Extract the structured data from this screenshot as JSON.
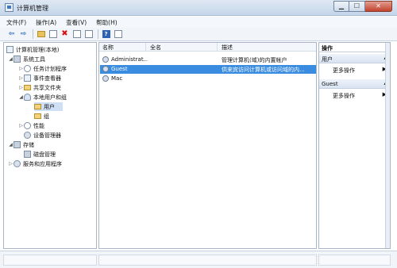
{
  "window": {
    "title": "计算机管理"
  },
  "menu": [
    "文件(F)",
    "操作(A)",
    "查看(V)",
    "帮助(H)"
  ],
  "toolbar": {
    "icons": [
      "back-arrow",
      "forward-arrow",
      "up-folder",
      "show-hide-tree",
      "delete",
      "properties",
      "export",
      "help",
      "console-view"
    ],
    "back_glyph": "⇦",
    "forward_glyph": "⇨",
    "delete_glyph": "✖",
    "help_glyph": "?"
  },
  "tree": {
    "root": "计算机管理(本地)",
    "system_tools": "系统工具",
    "task_scheduler": "任务计划程序",
    "event_viewer": "事件查看器",
    "shared_folders": "共享文件夹",
    "local_users": "本地用户和组",
    "users": "用户",
    "groups": "组",
    "performance": "性能",
    "device_manager": "设备管理器",
    "storage": "存储",
    "disk_management": "磁盘管理",
    "services": "服务和应用程序"
  },
  "table": {
    "columns": [
      "名称",
      "全名",
      "描述"
    ],
    "rows": [
      {
        "name": "Administrat...",
        "fullname": "",
        "desc": "管理计算机(域)的内置帐户"
      },
      {
        "name": "Guest",
        "fullname": "",
        "desc": "供来宾访问计算机或访问域的内..."
      },
      {
        "name": "Mac",
        "fullname": "",
        "desc": ""
      }
    ],
    "selected_index": 1
  },
  "actions": {
    "header": "操作",
    "section1": "用户",
    "more1": "更多操作",
    "section2": "Guest",
    "more2": "更多操作",
    "arrow": "▶"
  },
  "colors": {
    "selection": "#3a8ce0",
    "close_button": "#c2432d"
  }
}
